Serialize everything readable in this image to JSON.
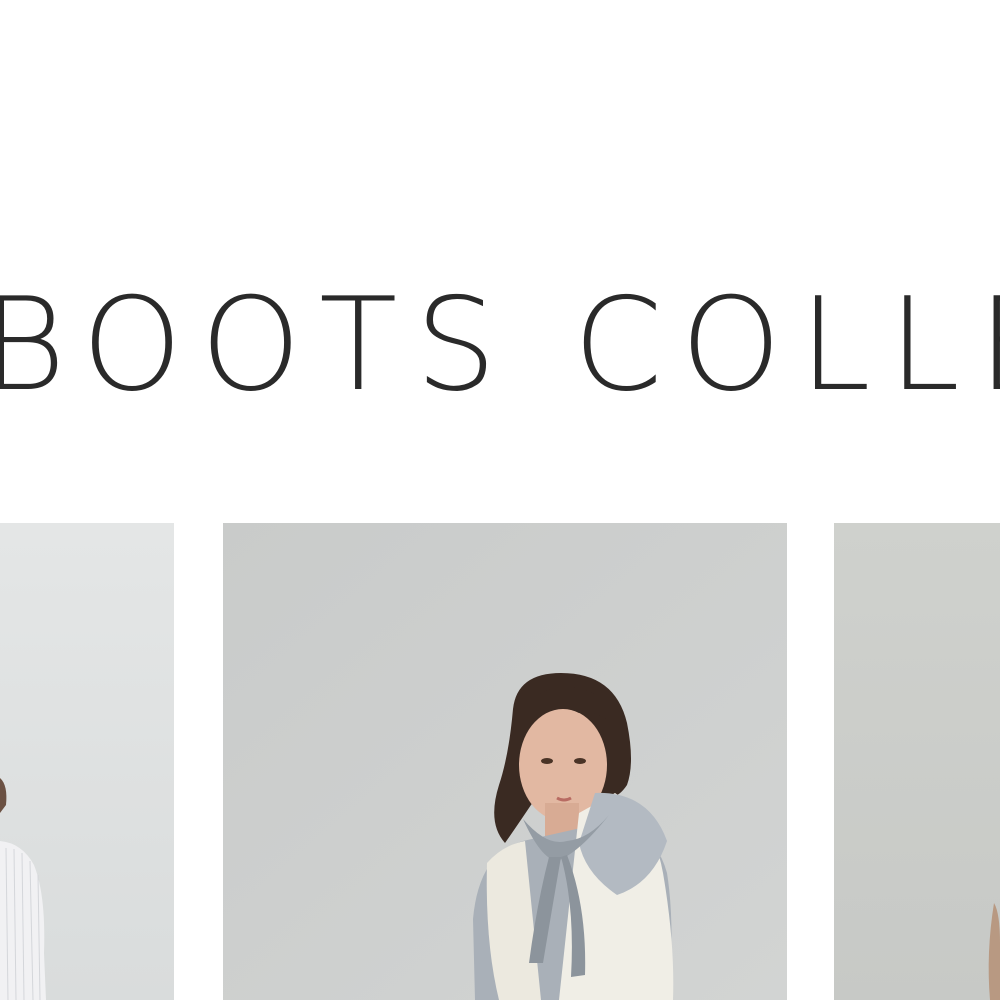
{
  "page": {
    "title": "BOOTS COLLE"
  },
  "gallery": {
    "items": [
      {
        "image_icon": "model-photo-icon"
      },
      {
        "image_icon": "model-photo-icon"
      },
      {
        "image_icon": "model-photo-icon"
      }
    ]
  },
  "colors": {
    "title_text": "#2a2a2a",
    "background": "#ffffff",
    "photo_backdrop": "#cbcdcc"
  }
}
